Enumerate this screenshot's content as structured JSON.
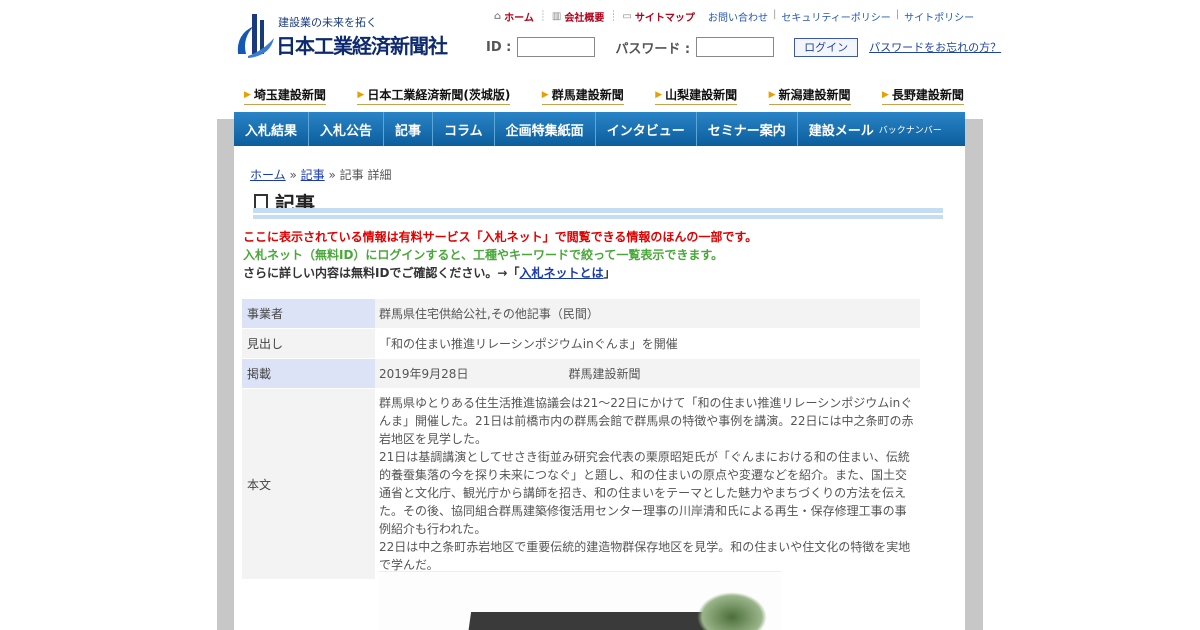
{
  "header": {
    "tagline": "建設業の未来を拓く",
    "company": "日本工業経済新聞社",
    "topnav": [
      {
        "icon": "home-icon",
        "label": "ホーム"
      },
      {
        "icon": "building-icon",
        "label": "会社概要"
      },
      {
        "icon": "sitemap-icon",
        "label": "サイトマップ"
      }
    ],
    "links": [
      "お問い合わせ",
      "セキュリティーポリシー",
      "サイトポリシー"
    ],
    "login": {
      "id_label": "ID :",
      "password_label": "パスワード :",
      "button": "ログイン",
      "forgot": "パスワードをお忘れの方？"
    }
  },
  "papers": [
    "埼玉建設新聞",
    "日本工業経済新聞(茨城版)",
    "群馬建設新聞",
    "山梨建設新聞",
    "新潟建設新聞",
    "長野建設新聞"
  ],
  "mainnav": [
    "入札結果",
    "入札公告",
    "記事",
    "コラム",
    "企画特集紙面",
    "インタビュー",
    "セミナー案内"
  ],
  "mainnav_last": {
    "label": "建設メール",
    "sub": "バックナンバー"
  },
  "breadcrumb": {
    "home": "ホーム",
    "sep": "»",
    "article": "記事",
    "current": "記事 詳細"
  },
  "page_title": "記事",
  "notices": {
    "line1": "ここに表示されている情報は有料サービス「入札ネット」で閲覧できる情報のほんの一部です。",
    "line2": "入札ネット（無料ID）にログインすると、工種やキーワードで絞って一覧表示できます。",
    "line3_prefix": "さらに詳しい内容は無料IDでご確認ください。→「",
    "line3_link": "入札ネットとは",
    "line3_suffix": "」"
  },
  "detail": {
    "rows": [
      {
        "label": "事業者",
        "value": "群馬県住宅供給公社,その他記事（民間）"
      },
      {
        "label": "見出し",
        "value": "「和の住まい推進リレーシンポジウムinぐんま」を開催"
      },
      {
        "label": "掲載",
        "date": "2019年9月28日",
        "paper": "群馬建設新聞"
      },
      {
        "label": "本文",
        "paragraphs": [
          "群馬県ゆとりある住生活推進協議会は21～22日にかけて「和の住まい推進リレーシンポジウムinぐんま」開催した。21日は前橋市内の群馬会館で群馬県の特徴や事例を講演。22日には中之条町の赤岩地区を見学した。",
          "21日は基調講演としてせさき街並み研究会代表の栗原昭矩氏が「ぐんまにおける和の住まい、伝統的養蚕集落の今を探り未来につなぐ」と題し、和の住まいの原点や変遷などを紹介。また、国土交通省と文化庁、観光庁から講師を招き、和の住まいをテーマとした魅力やまちづくりの方法を伝えた。その後、協同組合群馬建築修復活用センター理事の川岸清和氏による再生・保存修理工事の事例紹介も行われた。",
          "22日は中之条町赤岩地区で重要伝統的建造物群保存地区を見学。和の住まいや住文化の特徴を実地で学んだ。"
        ]
      }
    ]
  },
  "colors": {
    "nav_top": "#2a84c6",
    "nav_bottom": "#0b5e9c",
    "notice_red": "#e00000",
    "notice_green": "#4aa83a",
    "link": "#1a3bb0"
  }
}
